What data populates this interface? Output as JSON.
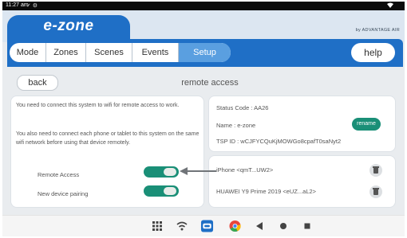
{
  "statusbar": {
    "time": "11:27 am",
    "icons": "✓ ⚙"
  },
  "brand": {
    "logo": "e-zone",
    "byline": "by ADVANTAGE AIR"
  },
  "nav": {
    "tabs": [
      "Mode",
      "Zones",
      "Scenes",
      "Events",
      "Setup"
    ],
    "active_tab": "Setup",
    "help_label": "help"
  },
  "page": {
    "back_label": "back",
    "title": "remote access"
  },
  "remote": {
    "message1": "You need to connect this system to wifi for remote access to work.",
    "message2": "You also need to connect each phone or tablet to this system on the same wifi network before using that device remotely.",
    "remote_access_label": "Remote Access",
    "remote_access_on": true,
    "new_device_pairing_label": "New device pairing",
    "new_device_pairing_on": true
  },
  "status": {
    "status_code": "Status Code : AA26",
    "name": "Name : e-zone",
    "tsp_id": "TSP ID : wCJFYCQuKjMOWGo8cpafT0saNyt2",
    "rename_label": "rename"
  },
  "devices": [
    {
      "label": "iPhone <qmT...UW2>"
    },
    {
      "label": "HUAWEI Y9 Prime 2019 <eUZ...aL2>"
    }
  ],
  "colors": {
    "brand_blue": "#1f6fc6",
    "active_tab": "#5a9fe0",
    "toggle_green": "#1a8f77"
  },
  "system_nav_icons": [
    "apps-grid-icon",
    "wifi-icon",
    "ezone-app-icon",
    "chrome-icon",
    "back-triangle-icon",
    "home-circle-icon",
    "recents-square-icon"
  ]
}
